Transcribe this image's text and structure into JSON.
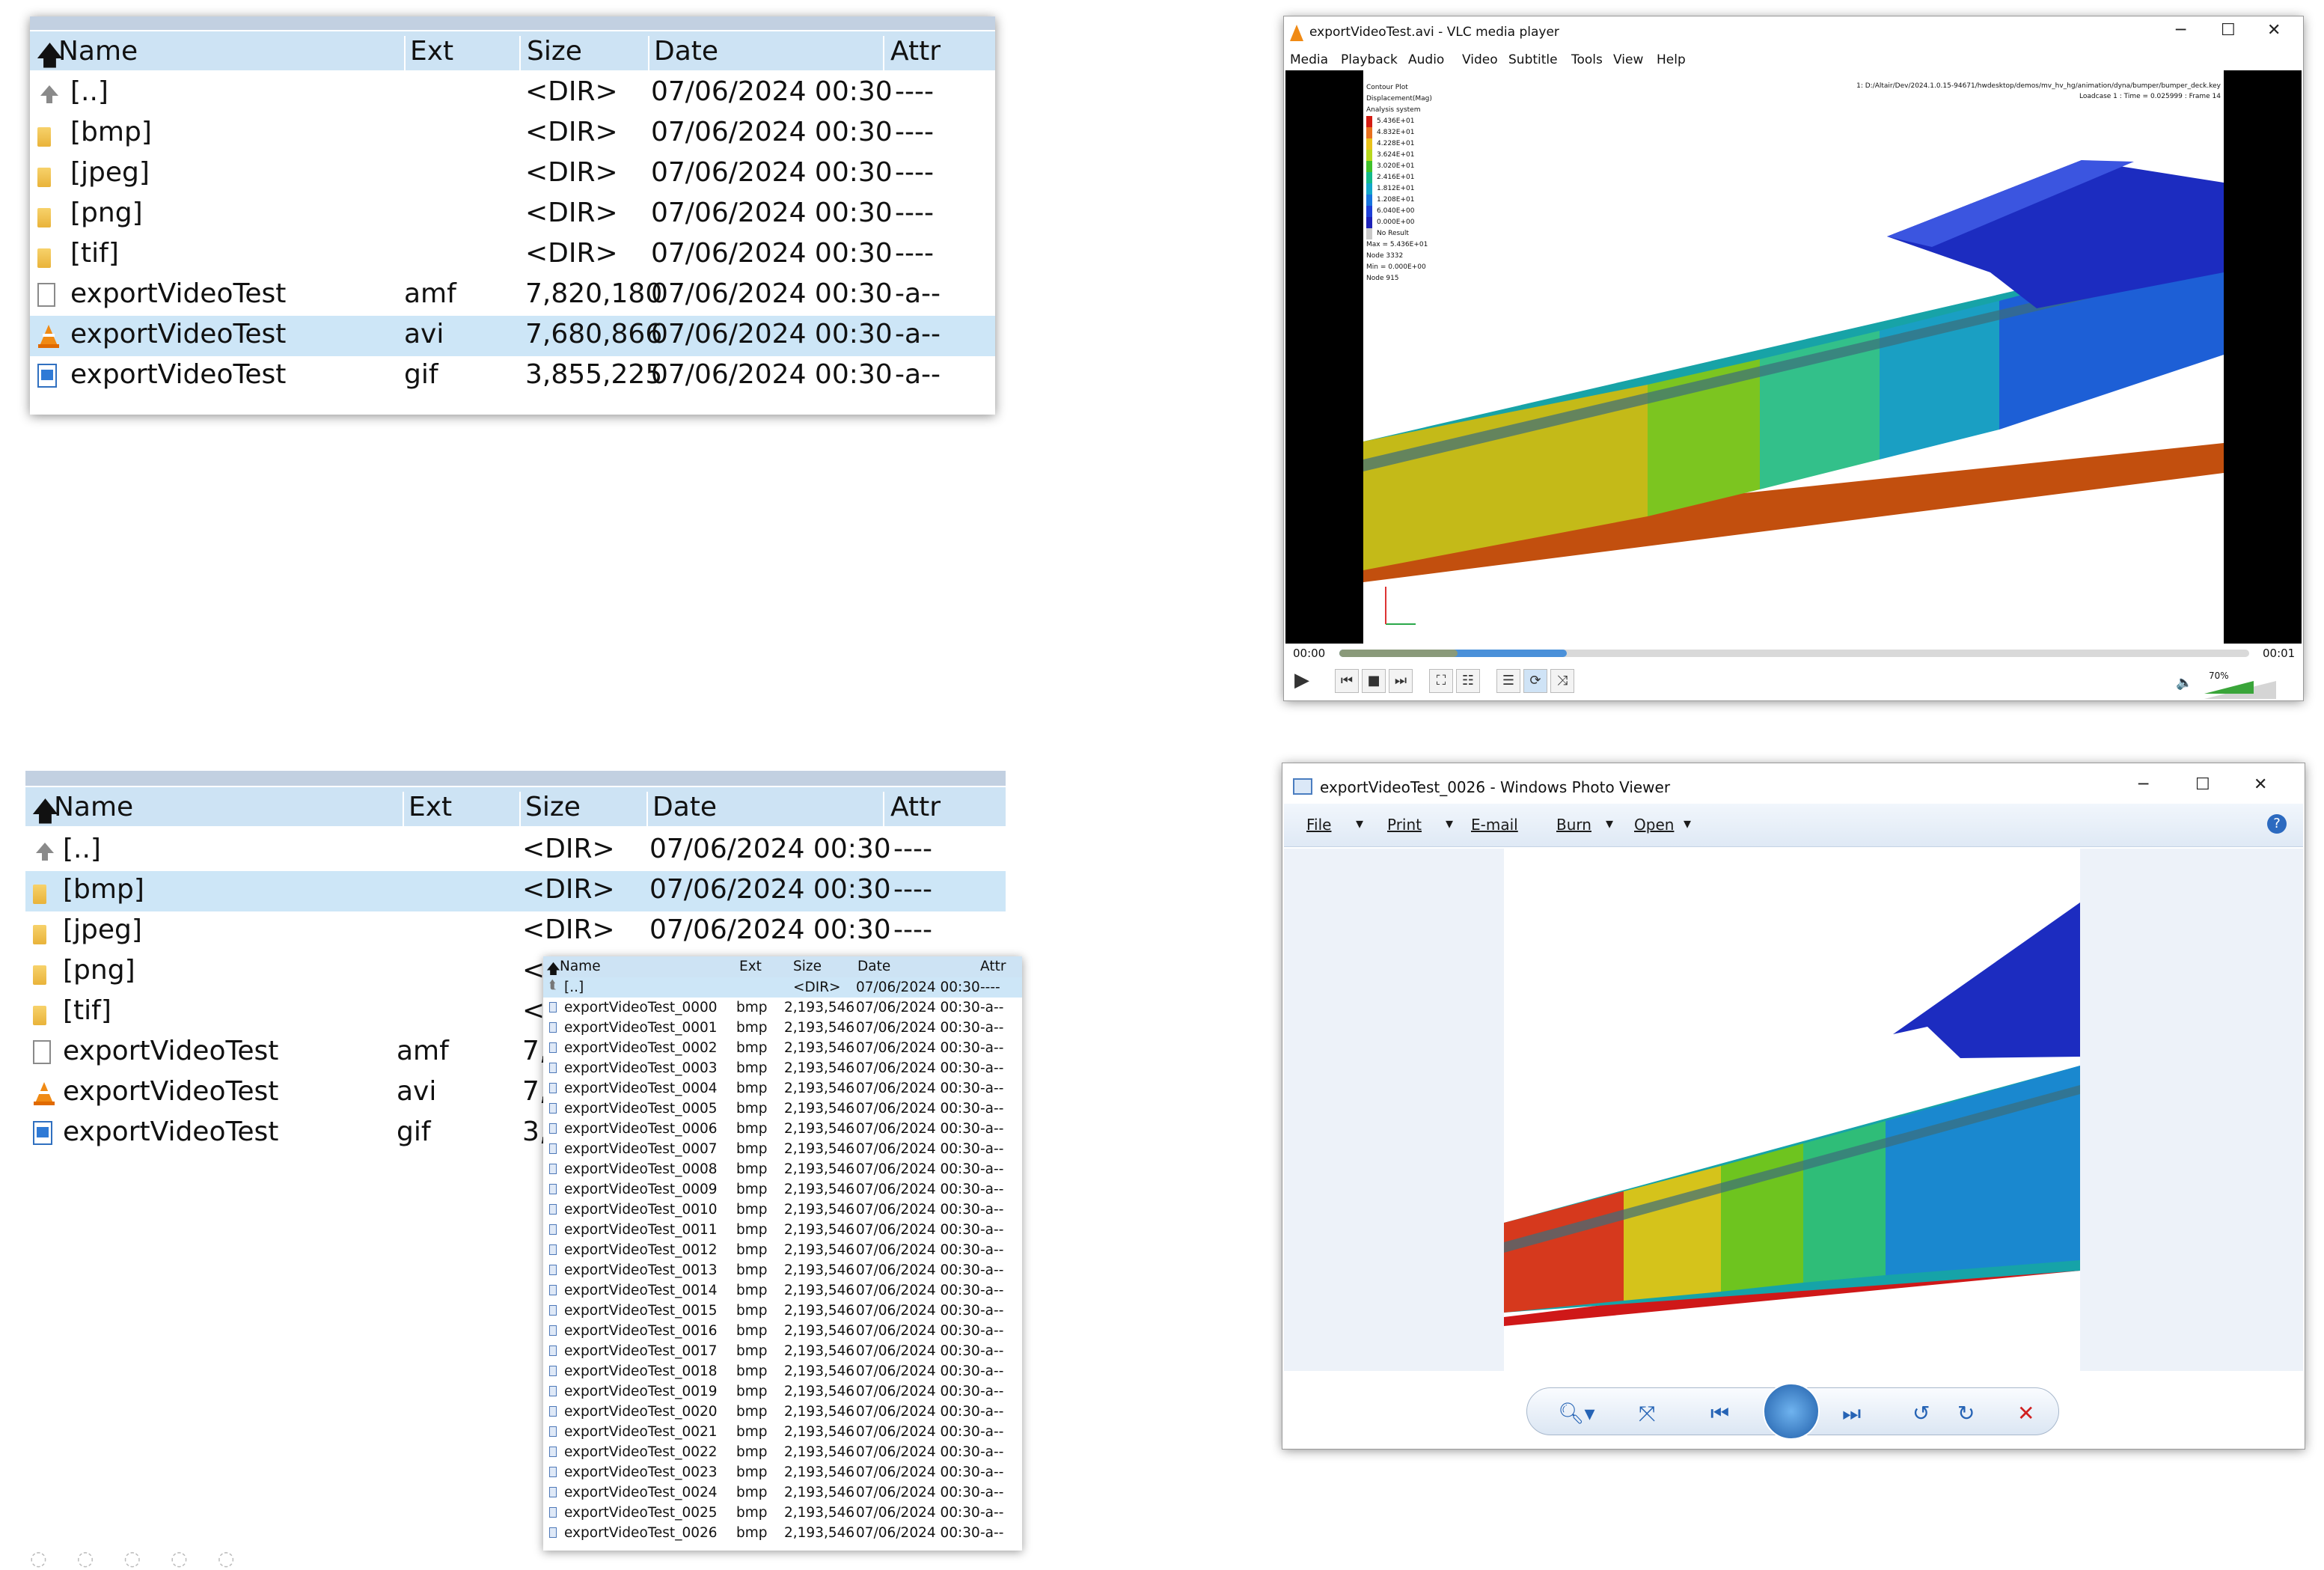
{
  "columns": {
    "name": "Name",
    "ext": "Ext",
    "size": "Size",
    "date": "Date",
    "attr": "Attr"
  },
  "panel1": {
    "rows": [
      {
        "icon": "up",
        "name": "[..]",
        "ext": "",
        "size": "<DIR>",
        "date": "07/06/2024 00:30",
        "attr": "----"
      },
      {
        "icon": "folder",
        "name": "[bmp]",
        "ext": "",
        "size": "<DIR>",
        "date": "07/06/2024 00:30",
        "attr": "----"
      },
      {
        "icon": "folder",
        "name": "[jpeg]",
        "ext": "",
        "size": "<DIR>",
        "date": "07/06/2024 00:30",
        "attr": "----"
      },
      {
        "icon": "folder",
        "name": "[png]",
        "ext": "",
        "size": "<DIR>",
        "date": "07/06/2024 00:30",
        "attr": "----"
      },
      {
        "icon": "folder",
        "name": "[tif]",
        "ext": "",
        "size": "<DIR>",
        "date": "07/06/2024 00:30",
        "attr": "----"
      },
      {
        "icon": "doc",
        "name": "exportVideoTest",
        "ext": "amf",
        "size": "7,820,180",
        "date": "07/06/2024 00:30",
        "attr": "-a--"
      },
      {
        "icon": "vlc",
        "name": "exportVideoTest",
        "ext": "avi",
        "size": "7,680,866",
        "date": "07/06/2024 00:30",
        "attr": "-a--",
        "selected": true
      },
      {
        "icon": "image",
        "name": "exportVideoTest",
        "ext": "gif",
        "size": "3,855,225",
        "date": "07/06/2024 00:30",
        "attr": "-a--"
      }
    ]
  },
  "panel2": {
    "rows": [
      {
        "icon": "up",
        "name": "[..]",
        "ext": "",
        "size": "<DIR>",
        "date": "07/06/2024 00:30",
        "attr": "----"
      },
      {
        "icon": "folder",
        "name": "[bmp]",
        "ext": "",
        "size": "<DIR>",
        "date": "07/06/2024 00:30",
        "attr": "----",
        "selected": true
      },
      {
        "icon": "folder",
        "name": "[jpeg]",
        "ext": "",
        "size": "<DIR>",
        "date": "07/06/2024 00:30",
        "attr": "----"
      },
      {
        "icon": "folder",
        "name": "[png]",
        "ext": "",
        "size": "<",
        "date": "",
        "attr": ""
      },
      {
        "icon": "folder",
        "name": "[tif]",
        "ext": "",
        "size": "<",
        "date": "",
        "attr": ""
      },
      {
        "icon": "doc",
        "name": "exportVideoTest",
        "ext": "amf",
        "size": "7,8",
        "date": "",
        "attr": ""
      },
      {
        "icon": "vlc",
        "name": "exportVideoTest",
        "ext": "avi",
        "size": "7,6",
        "date": "",
        "attr": ""
      },
      {
        "icon": "image",
        "name": "exportVideoTest",
        "ext": "gif",
        "size": "3,8",
        "date": "",
        "attr": ""
      }
    ]
  },
  "bmp_listing": {
    "parent": {
      "name": "[..]",
      "size": "<DIR>",
      "date": "07/06/2024 00:30",
      "attr": "----"
    },
    "ext": "bmp",
    "size": "2,193,546",
    "date": "07/06/2024 00:30",
    "attr": "-a--",
    "names": [
      "exportVideoTest_0000",
      "exportVideoTest_0001",
      "exportVideoTest_0002",
      "exportVideoTest_0003",
      "exportVideoTest_0004",
      "exportVideoTest_0005",
      "exportVideoTest_0006",
      "exportVideoTest_0007",
      "exportVideoTest_0008",
      "exportVideoTest_0009",
      "exportVideoTest_0010",
      "exportVideoTest_0011",
      "exportVideoTest_0012",
      "exportVideoTest_0013",
      "exportVideoTest_0014",
      "exportVideoTest_0015",
      "exportVideoTest_0016",
      "exportVideoTest_0017",
      "exportVideoTest_0018",
      "exportVideoTest_0019",
      "exportVideoTest_0020",
      "exportVideoTest_0021",
      "exportVideoTest_0022",
      "exportVideoTest_0023",
      "exportVideoTest_0024",
      "exportVideoTest_0025",
      "exportVideoTest_0026"
    ]
  },
  "vlc": {
    "title": "exportVideoTest.avi - VLC media player",
    "menu": [
      "Media",
      "Playback",
      "Audio",
      "Video",
      "Subtitle",
      "Tools",
      "View",
      "Help"
    ],
    "path_text": "1: D:/Altair/Dev/2024.1.0.15-94671/hwdesktop/demos/mv_hv_hg/animation/dyna/bumper/bumper_deck.key",
    "loadcase_text": "Loadcase 1 : Time = 0.025999 : Frame 14",
    "legend_title": [
      "Contour Plot",
      "Displacement(Mag)",
      "Analysis system"
    ],
    "legend_values": [
      "5.436E+01",
      "4.832E+01",
      "4.228E+01",
      "3.624E+01",
      "3.020E+01",
      "2.416E+01",
      "1.812E+01",
      "1.208E+01",
      "6.040E+00",
      "0.000E+00",
      "No Result"
    ],
    "legend_colors": [
      "#d41b12",
      "#e8701e",
      "#e9c21a",
      "#b7d81d",
      "#3fc12a",
      "#12b98a",
      "#13a6c9",
      "#1674de",
      "#1c3fd8",
      "#1c21b8",
      "#c9c9c9"
    ],
    "stats": [
      "Max = 5.436E+01",
      "Node 3332",
      "Min = 0.000E+00",
      "Node 915"
    ],
    "time_start": "00:00",
    "time_end": "00:01",
    "volume": "70%",
    "progress": 0.13,
    "buffer": 0.25
  },
  "photo_viewer": {
    "title": "exportVideoTest_0026 - Windows Photo Viewer",
    "menu": [
      "File",
      "Print",
      "E-mail",
      "Burn",
      "Open"
    ]
  }
}
